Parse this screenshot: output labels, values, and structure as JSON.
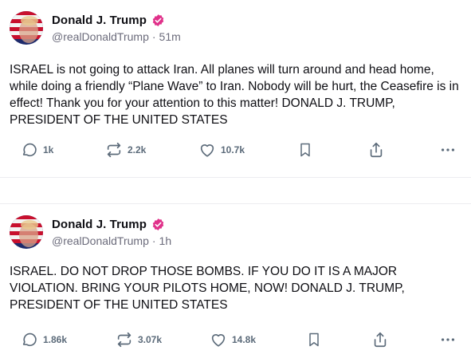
{
  "posts": [
    {
      "author": {
        "display_name": "Donald J. Trump",
        "handle": "@realDonaldTrump",
        "time": "51m"
      },
      "text": "ISRAEL is not going to attack Iran. All planes will turn around and head home, while doing a friendly “Plane Wave” to Iran. Nobody will be hurt, the Ceasefire is in effect! Thank you for your attention to this matter! DONALD J. TRUMP, PRESIDENT OF THE UNITED STATES",
      "stats": {
        "replies": "1k",
        "reposts": "2.2k",
        "likes": "10.7k"
      }
    },
    {
      "author": {
        "display_name": "Donald J. Trump",
        "handle": "@realDonaldTrump",
        "time": "1h"
      },
      "text": "ISRAEL. DO NOT DROP THOSE BOMBS. IF YOU DO IT IS A MAJOR VIOLATION. BRING YOUR PILOTS HOME, NOW!  DONALD J. TRUMP, PRESIDENT OF THE UNITED STATES",
      "stats": {
        "replies": "1.86k",
        "reposts": "3.07k",
        "likes": "14.8k"
      }
    }
  ],
  "separator": "·",
  "icons": {
    "reply": "speech-bubble-icon",
    "repost": "repost-arrows-icon",
    "like": "heart-icon",
    "bookmark": "bookmark-icon",
    "share": "share-upload-icon",
    "more": "more-dots-icon",
    "verified": "verified-badge-icon"
  },
  "colors": {
    "verified_badge": "#e0318a",
    "action_icon": "#5c6b7a",
    "handle_text": "#6b6b7b",
    "divider": "#ececf0"
  }
}
